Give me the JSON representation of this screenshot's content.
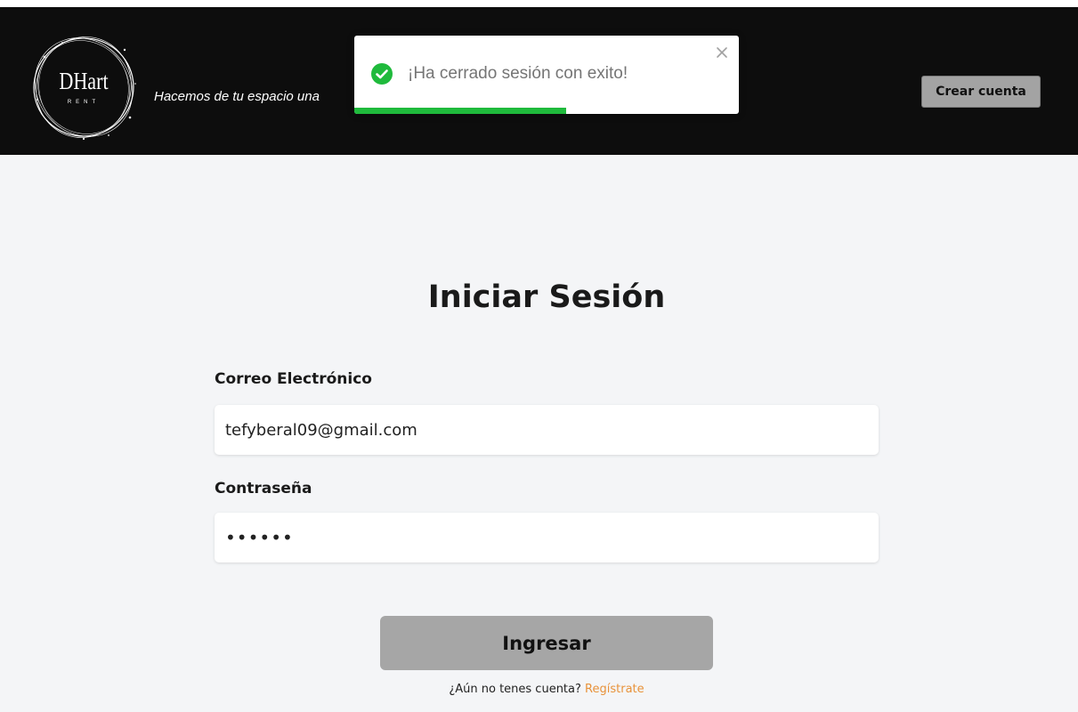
{
  "header": {
    "logo": {
      "text": "DHart",
      "subtext": "RENT"
    },
    "tagline": "Hacemos de tu espacio una",
    "create_account_label": "Crear cuenta"
  },
  "toast": {
    "message": "¡Ha cerrado sesión con exito!",
    "type": "success",
    "progress": 0.55,
    "icon": "check-circle-icon",
    "close_icon": "close-icon"
  },
  "login_form": {
    "title": "Iniciar Sesión",
    "email_label": "Correo Electrónico",
    "email_value": "tefyberal09@gmail.com",
    "password_label": "Contraseña",
    "password_value": "123456",
    "submit_label": "Ingresar",
    "register_prompt": "¿Aún no tenes cuenta?",
    "register_link": "Regístrate"
  },
  "colors": {
    "header_bg": "#0d0d0d",
    "page_bg": "#f4f5f7",
    "toast_progress": "#1fba3c",
    "toast_icon": "#1fba3c",
    "link": "#e8923a",
    "button_bg": "#a6a6a6"
  }
}
